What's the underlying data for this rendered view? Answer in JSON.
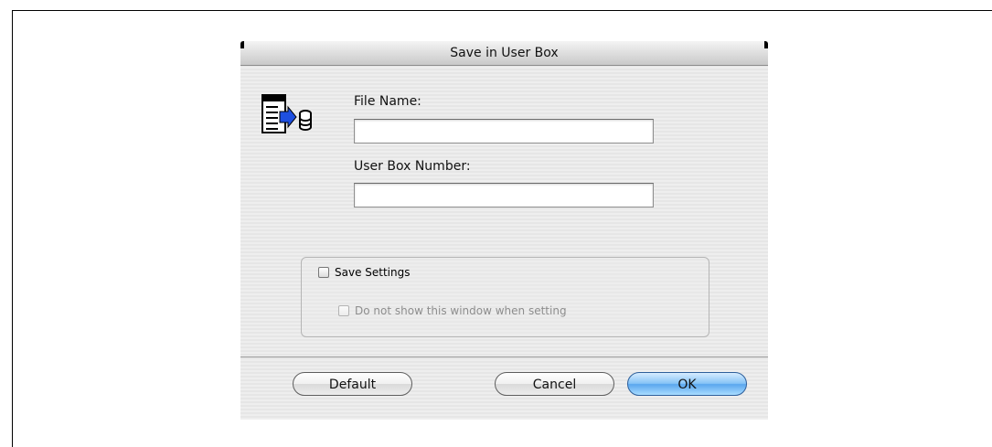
{
  "dialog": {
    "title": "Save in User Box",
    "icon": "save-to-box-icon"
  },
  "form": {
    "file_name_label": "File Name:",
    "file_name_value": "",
    "user_box_number_label": "User Box Number:",
    "user_box_number_value": ""
  },
  "settings": {
    "save_settings_label": "Save Settings",
    "save_settings_checked": false,
    "do_not_show_label": "Do not show this window when setting",
    "do_not_show_checked": false,
    "do_not_show_enabled": false
  },
  "buttons": {
    "default_label": "Default",
    "cancel_label": "Cancel",
    "ok_label": "OK"
  },
  "colors": {
    "ok_button": "#6fb6f2",
    "dialog_background": "#e9e9e9"
  }
}
